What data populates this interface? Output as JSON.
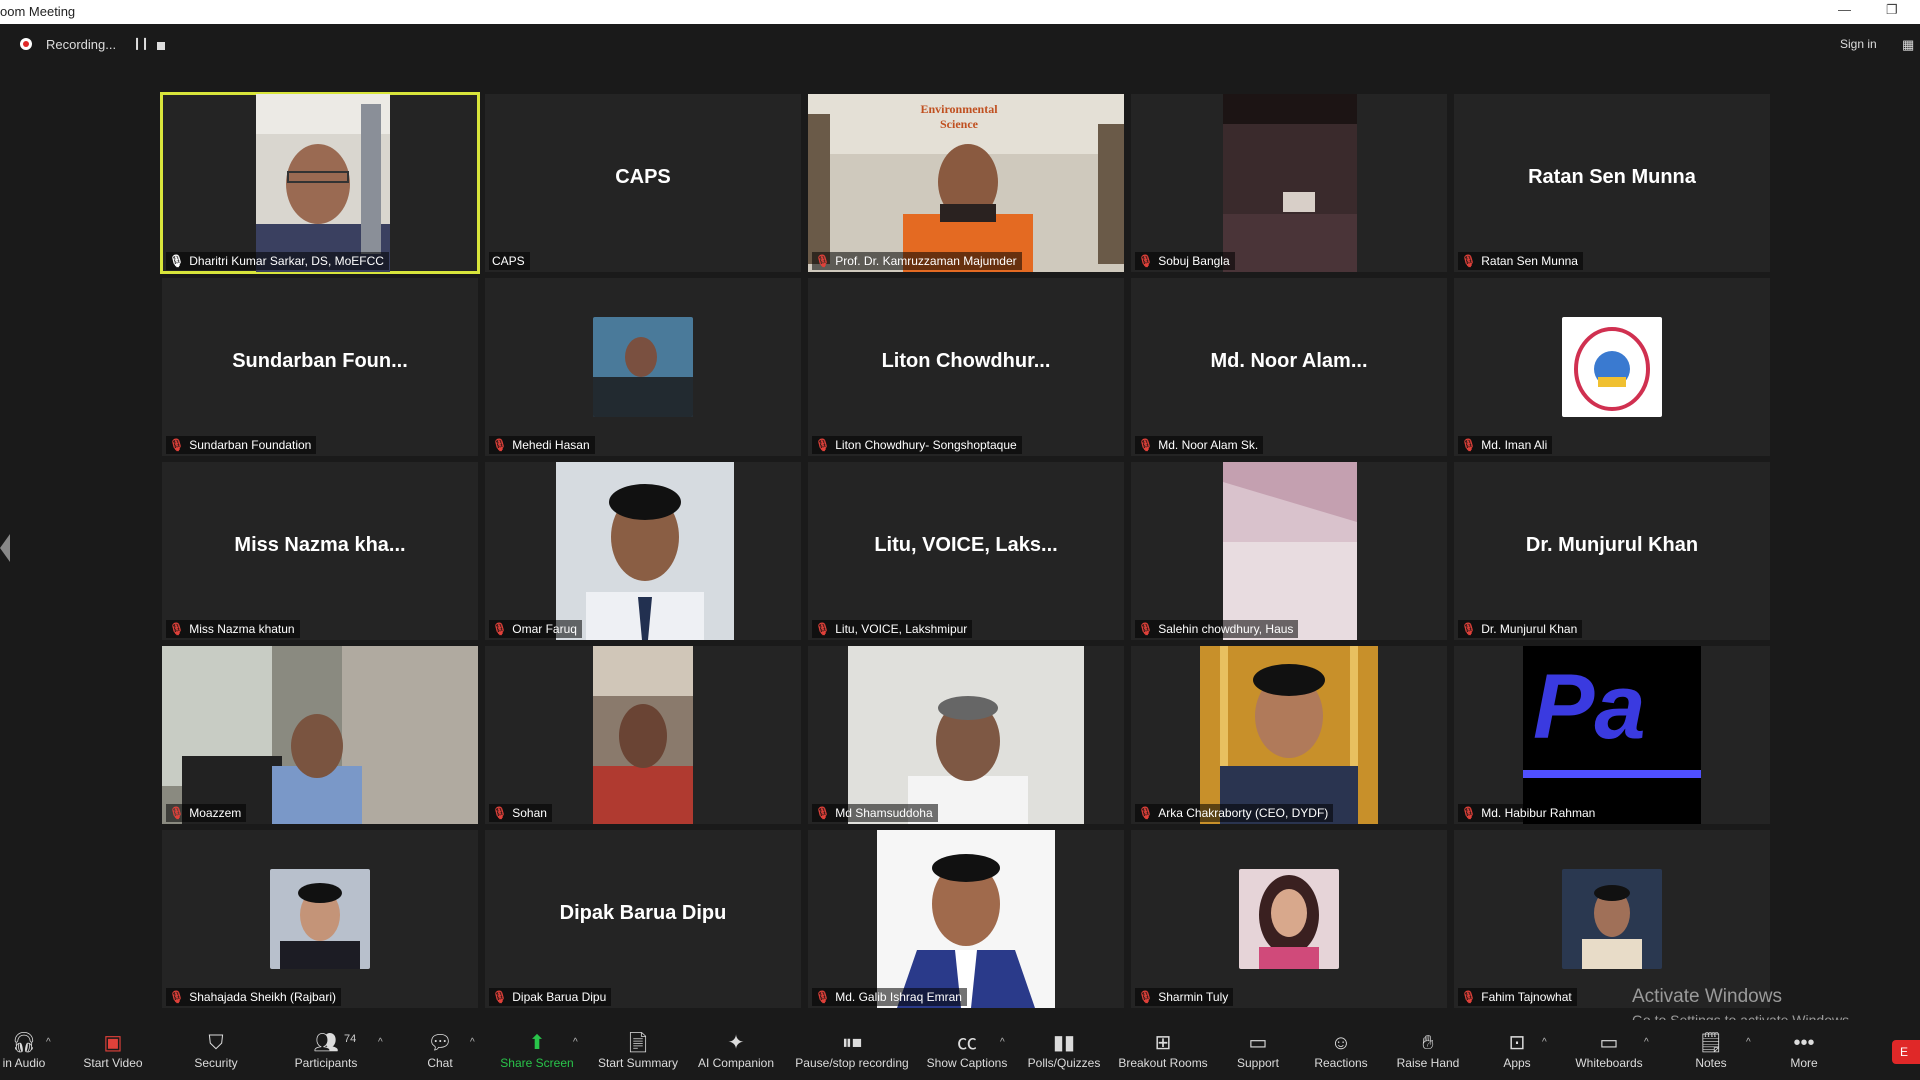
{
  "window": {
    "title": "oom Meeting",
    "minimize_icon": "minimize-icon",
    "restore_icon": "restore-icon"
  },
  "topbar": {
    "recording_label": "Recording...",
    "sign_in": "Sign in"
  },
  "tiles": [
    {
      "name": "Dharitri Kumar Sarkar, DS, MoEFCC",
      "display": "",
      "muted": false,
      "active": true
    },
    {
      "name": "CAPS",
      "display": "CAPS",
      "muted": null
    },
    {
      "name": "Prof. Dr. Kamruzzaman Majumder",
      "display": "",
      "muted": true
    },
    {
      "name": "Sobuj Bangla",
      "display": "",
      "muted": true
    },
    {
      "name": "Ratan Sen Munna",
      "display": "Ratan Sen Munna",
      "muted": true
    },
    {
      "name": "Sundarban Foundation",
      "display": "Sundarban Foun...",
      "muted": true
    },
    {
      "name": "Mehedi Hasan",
      "display": "",
      "muted": true
    },
    {
      "name": "Liton Chowdhury- Songshoptaque",
      "display": "Liton Chowdhur...",
      "muted": true
    },
    {
      "name": "Md. Noor Alam Sk.",
      "display": "Md. Noor Alam...",
      "muted": true
    },
    {
      "name": "Md. Iman Ali",
      "display": "",
      "muted": true
    },
    {
      "name": "Miss Nazma khatun",
      "display": "Miss Nazma kha...",
      "muted": true
    },
    {
      "name": "Omar Faruq",
      "display": "",
      "muted": true
    },
    {
      "name": "Litu, VOICE, Lakshmipur",
      "display": "Litu, VOICE, Laks...",
      "muted": true
    },
    {
      "name": "Salehin chowdhury, Haus",
      "display": "",
      "muted": true
    },
    {
      "name": "Dr. Munjurul Khan",
      "display": "Dr. Munjurul Khan",
      "muted": true
    },
    {
      "name": "Moazzem",
      "display": "",
      "muted": true
    },
    {
      "name": "Sohan",
      "display": "",
      "muted": true
    },
    {
      "name": "Md Shamsuddoha",
      "display": "",
      "muted": true
    },
    {
      "name": "Arka Chakraborty (CEO, DYDF)",
      "display": "",
      "muted": true
    },
    {
      "name": "Md. Habibur Rahman",
      "display": "",
      "muted": true
    },
    {
      "name": "Shahajada Sheikh (Rajbari)",
      "display": "",
      "muted": true
    },
    {
      "name": "Dipak Barua Dipu",
      "display": "Dipak Barua Dipu",
      "muted": true
    },
    {
      "name": "Md. Galib Ishraq Emran",
      "display": "",
      "muted": true
    },
    {
      "name": "Sharmin Tuly",
      "display": "",
      "muted": true
    },
    {
      "name": "Fahim Tajnowhat",
      "display": "",
      "muted": true
    }
  ],
  "environmental_sign": "Environmental Science",
  "toolbar": {
    "join_audio": "in Audio",
    "start_video": "Start Video",
    "security": "Security",
    "participants": "Participants",
    "participants_count": "74",
    "chat": "Chat",
    "share_screen": "Share Screen",
    "start_summary": "Start Summary",
    "ai_companion": "AI Companion",
    "pause_stop_recording": "Pause/stop recording",
    "show_captions": "Show Captions",
    "polls": "Polls/Quizzes",
    "breakout_rooms": "Breakout Rooms",
    "support": "Support",
    "reactions": "Reactions",
    "raise_hand": "Raise Hand",
    "apps": "Apps",
    "whiteboards": "Whiteboards",
    "notes": "Notes",
    "more": "More",
    "end": "E"
  },
  "activate_windows": {
    "title": "Activate Windows",
    "subtitle": "Go to Settings to activate Windows."
  }
}
